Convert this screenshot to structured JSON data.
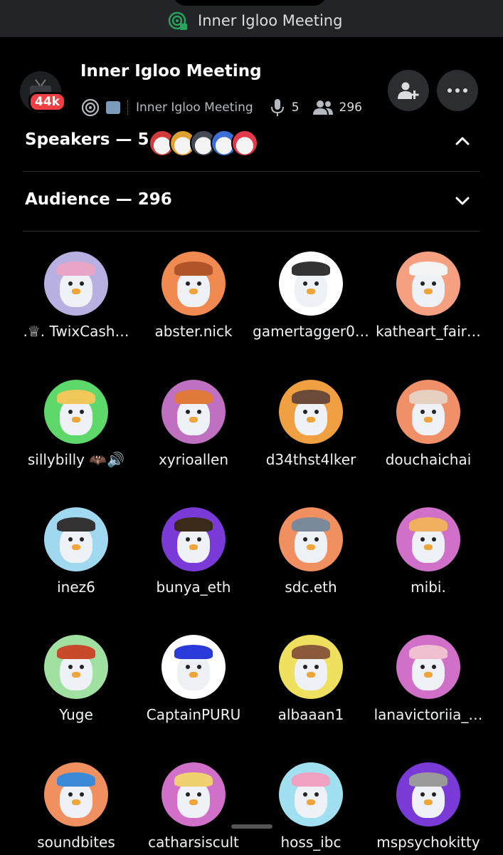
{
  "topbar": {
    "title": "Inner Igloo Meeting",
    "icon": "stage-lock-icon",
    "icon_color": "#23a55a"
  },
  "header": {
    "badge": "44k",
    "title": "Inner Igloo Meeting",
    "channel": "Inner Igloo Meeting",
    "speaker_count": "5",
    "listener_count": "296",
    "icons": [
      "stage-icon",
      "ice-emoji",
      "microphone-icon",
      "people-icon",
      "add-person-icon",
      "more-icon"
    ]
  },
  "sections": {
    "speakers": "Speakers — 5",
    "audience": "Audience — 296"
  },
  "speaker_avatars": [
    "#d33a3a",
    "#e0a030",
    "#444a55",
    "#3a6fd8",
    "#e23a4a"
  ],
  "audience": [
    {
      "name": ".♕. TwixCash…",
      "bg": "#b8b0e0",
      "hat": "#e8a5c6"
    },
    {
      "name": "abster.nick",
      "bg": "#f08a50",
      "hat": "#b0552a"
    },
    {
      "name": "gamertagger0…",
      "bg": "#ffffff",
      "hat": "#333333"
    },
    {
      "name": "katheart_fair…",
      "bg": "#f5a080",
      "hat": "#f3f3f3"
    },
    {
      "name": "sillybilly 🦇🔊",
      "bg": "#5ed86a",
      "hat": "#f0c85a"
    },
    {
      "name": "xyrioallen",
      "bg": "#c070c0",
      "hat": "#e07a3a"
    },
    {
      "name": "d34thst4lker",
      "bg": "#f0a040",
      "hat": "#6b4a3a"
    },
    {
      "name": "douchaichai",
      "bg": "#f09068",
      "hat": "#e8d0c0"
    },
    {
      "name": "inez6",
      "bg": "#a0d8f0",
      "hat": "#333333"
    },
    {
      "name": "bunya_eth",
      "bg": "#7a3ad8",
      "hat": "#3a2a1a"
    },
    {
      "name": "sdc.eth",
      "bg": "#f09060",
      "hat": "#7a8a9a"
    },
    {
      "name": "mibi.",
      "bg": "#d070c8",
      "hat": "#f0b060"
    },
    {
      "name": "Yuge",
      "bg": "#a0e0a0",
      "hat": "#c84a2a"
    },
    {
      "name": "CaptainPURU",
      "bg": "#ffffff",
      "hat": "#2a3ad8"
    },
    {
      "name": "albaaan1",
      "bg": "#f0e060",
      "hat": "#8a5a3a"
    },
    {
      "name": "lanavictoriia_…",
      "bg": "#d070c8",
      "hat": "#f0c0d0"
    },
    {
      "name": "soundbites",
      "bg": "#f09060",
      "hat": "#3a8ad8"
    },
    {
      "name": "catharsiscult",
      "bg": "#d070c8",
      "hat": "#f0d070"
    },
    {
      "name": "hoss_ibc",
      "bg": "#a0e0f0",
      "hat": "#f0a0c0"
    },
    {
      "name": "mspsychokitty",
      "bg": "#7a3ad8",
      "hat": "#9a9a9a"
    }
  ]
}
